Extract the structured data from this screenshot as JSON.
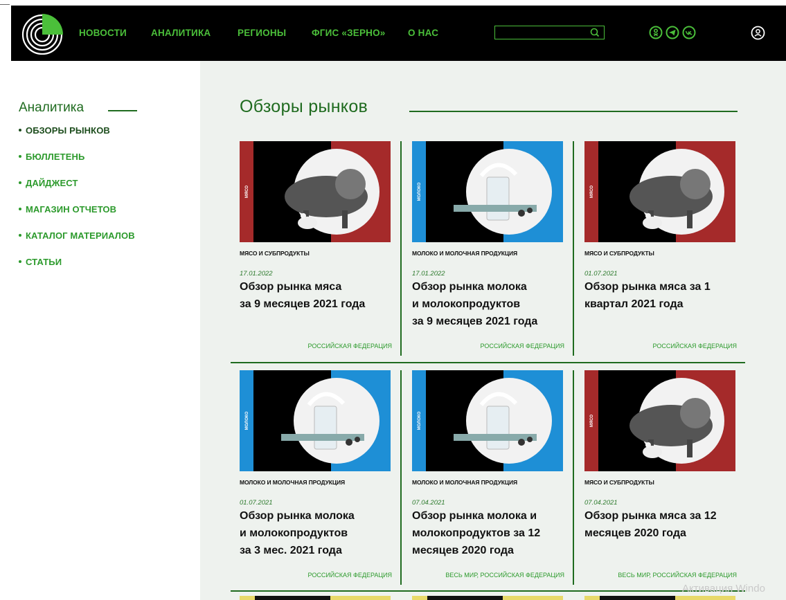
{
  "header": {
    "nav": [
      {
        "label": "НОВОСТИ"
      },
      {
        "label": "АНАЛИТИКА"
      },
      {
        "label": "РЕГИОНЫ"
      },
      {
        "label": "ФГИС «ЗЕРНО»"
      },
      {
        "label": "О НАС"
      }
    ],
    "search": {
      "value": "",
      "placeholder": ""
    },
    "social": [
      "odnoklassniki-icon",
      "telegram-icon",
      "vk-icon"
    ],
    "accent_color": "#4bbf3a"
  },
  "sidebar": {
    "title": "Аналитика",
    "items": [
      {
        "label": "ОБЗОРЫ РЫНКОВ",
        "active": true
      },
      {
        "label": "БЮЛЛЕТЕНЬ"
      },
      {
        "label": "ДАЙДЖЕСТ"
      },
      {
        "label": "МАГАЗИН ОТЧЕТОВ"
      },
      {
        "label": "КАТАЛОГ МАТЕРИАЛОВ"
      },
      {
        "label": "СТАТЬИ"
      }
    ]
  },
  "main": {
    "title": "Обзоры рынков",
    "cards": [
      {
        "image_type": "meat",
        "image_label": "МЯСО",
        "category": "МЯСО И СУБПРОДУКТЫ",
        "date": "17.01.2022",
        "title_lines": [
          "Обзор рынка мяса",
          "за 9 месяцев 2021 года"
        ],
        "region": "РОССИЙСКАЯ ФЕДЕРАЦИЯ"
      },
      {
        "image_type": "milk",
        "image_label": "МОЛОКО",
        "category": "МОЛОКО И МОЛОЧНАЯ ПРОДУКЦИЯ",
        "date": "17.01.2022",
        "title_lines": [
          "Обзор рынка молока",
          "и молокопродуктов",
          "за 9 месяцев 2021 года"
        ],
        "region": "РОССИЙСКАЯ ФЕДЕРАЦИЯ"
      },
      {
        "image_type": "meat",
        "image_label": "МЯСО",
        "category": "МЯСО И СУБПРОДУКТЫ",
        "date": "01.07.2021",
        "title_lines": [
          "Обзор рынка мяса за 1",
          "квартал 2021 года"
        ],
        "region": "РОССИЙСКАЯ ФЕДЕРАЦИЯ"
      },
      {
        "image_type": "milk",
        "image_label": "МОЛОКО",
        "category": "МОЛОКО И МОЛОЧНАЯ ПРОДУКЦИЯ",
        "date": "01.07.2021",
        "title_lines": [
          "Обзор рынка молока",
          "и молокопродуктов",
          "за 3 мес. 2021 года"
        ],
        "region": "РОССИЙСКАЯ ФЕДЕРАЦИЯ"
      },
      {
        "image_type": "milk",
        "image_label": "МОЛОКО",
        "category": "МОЛОКО И МОЛОЧНАЯ ПРОДУКЦИЯ",
        "date": "07.04.2021",
        "title_lines": [
          "Обзор рынка молока и",
          "молокопродуктов за 12",
          "месяцев 2020 года"
        ],
        "region": "ВЕСЬ МИР, РОССИЙСКАЯ ФЕДЕРАЦИЯ"
      },
      {
        "image_type": "meat",
        "image_label": "МЯСО",
        "category": "МЯСО И СУБПРОДУКТЫ",
        "date": "07.04.2021",
        "title_lines": [
          "Обзор рынка мяса за 12",
          "месяцев 2020 года"
        ],
        "region": "ВЕСЬ МИР, РОССИЙСКАЯ ФЕДЕРАЦИЯ"
      }
    ],
    "colors": {
      "meat": "#a52a2a",
      "milk": "#1e8fd6"
    }
  },
  "watermark": "Активация Windo"
}
